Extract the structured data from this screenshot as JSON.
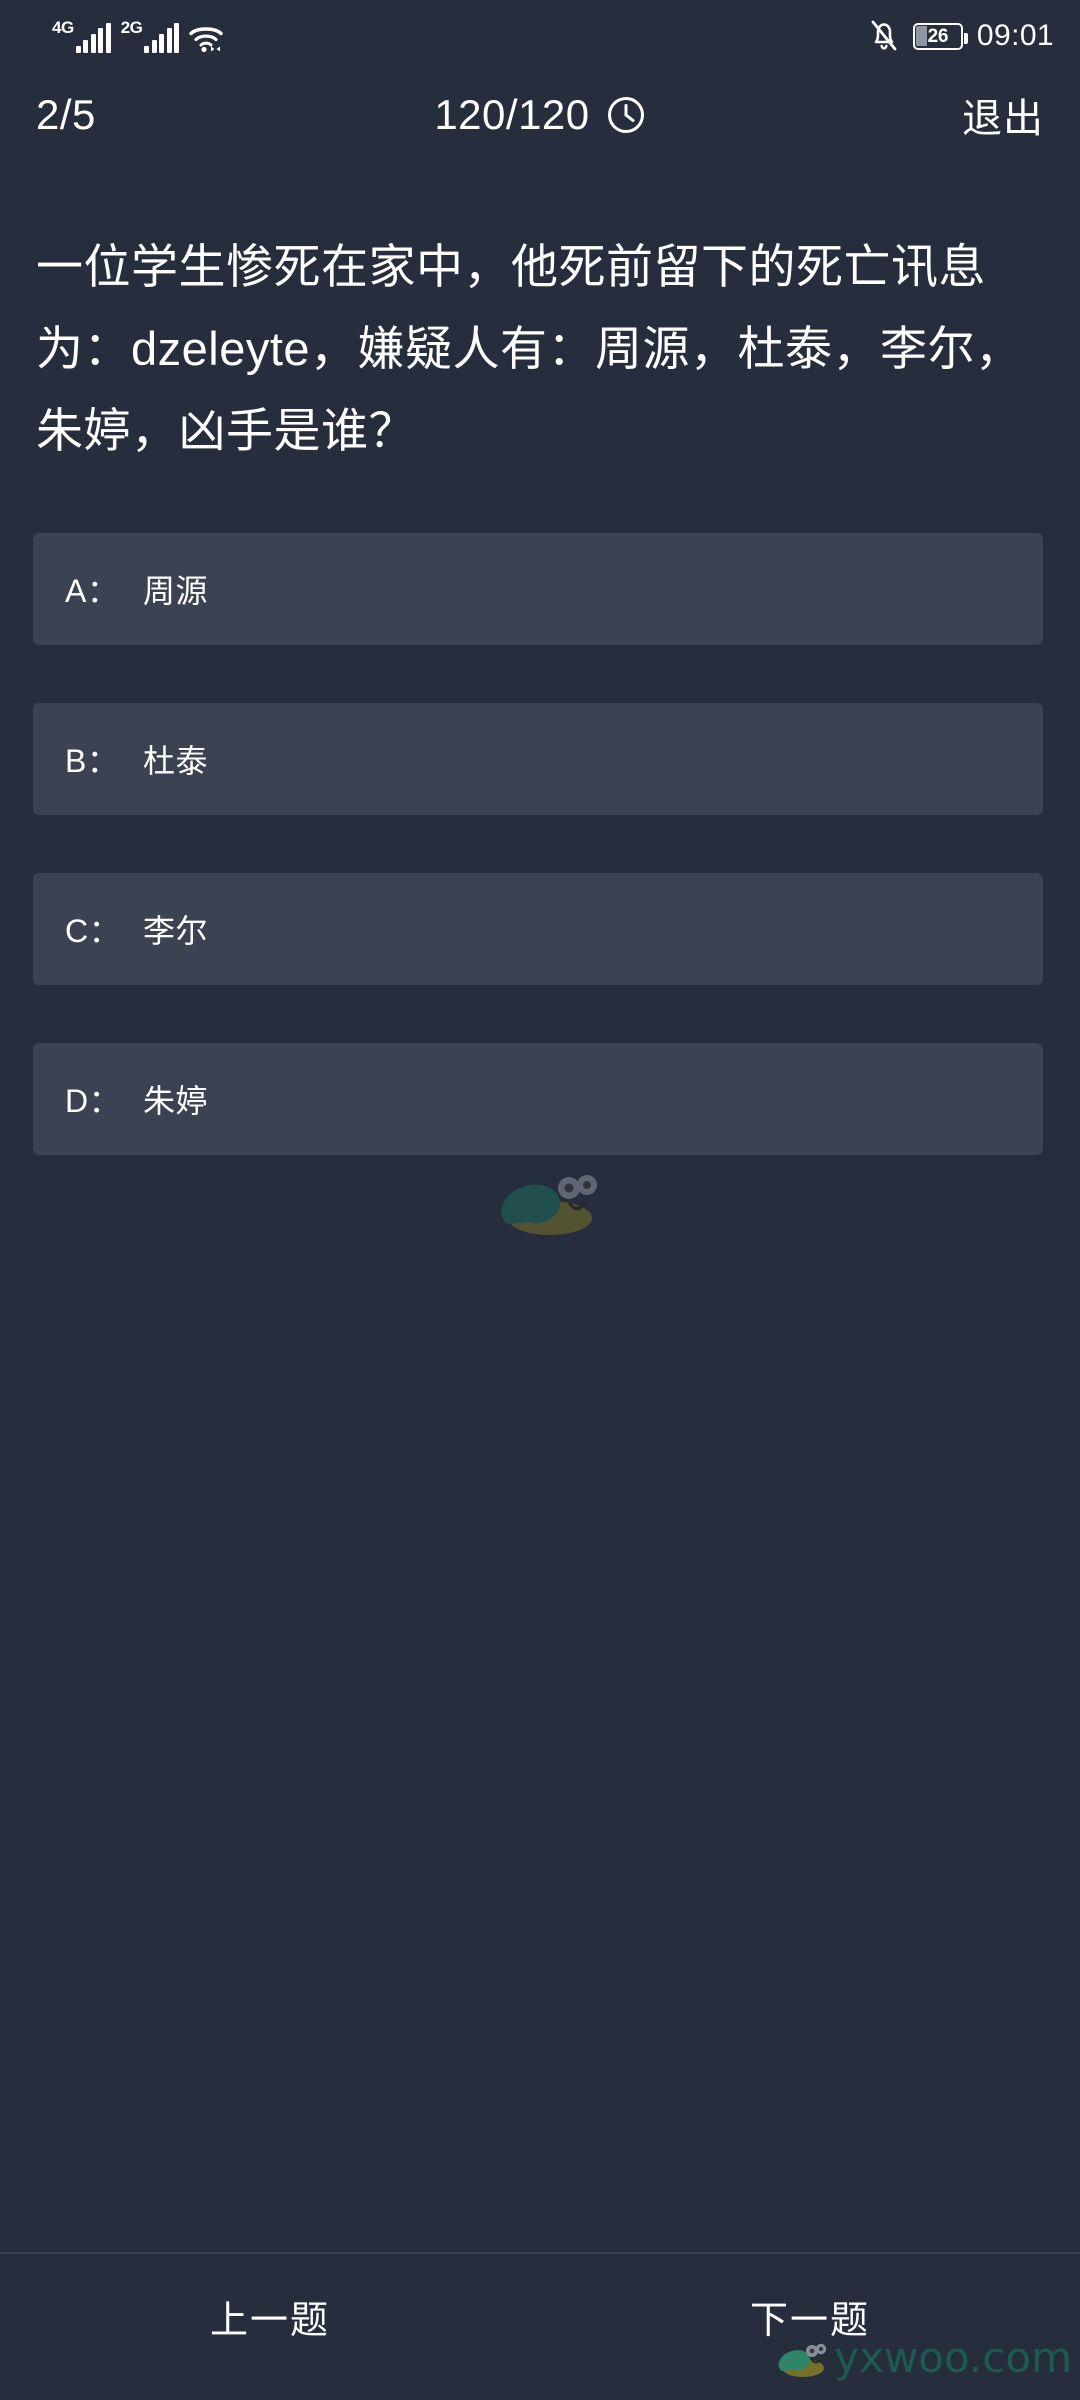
{
  "status_bar": {
    "network_1": "4G",
    "network_2": "2G",
    "wifi_icon": "wifi-icon",
    "bell_icon": "bell-off-icon",
    "battery_level": "26",
    "time": "09:01"
  },
  "header": {
    "progress": "2/5",
    "timer": "120/120",
    "timer_icon": "clock-icon",
    "exit_label": "退出"
  },
  "question": {
    "text": "一位学生惨死在家中，他死前留下的死亡讯息为：dzeleyte，嫌疑人有：周源，杜泰，李尔，朱婷，凶手是谁？"
  },
  "options": [
    {
      "letter": "A：",
      "text": "周源"
    },
    {
      "letter": "B：",
      "text": "杜泰"
    },
    {
      "letter": "C：",
      "text": "李尔"
    },
    {
      "letter": "D：",
      "text": "朱婷"
    }
  ],
  "bottom_nav": {
    "prev_label": "上一题",
    "next_label": "下一题"
  },
  "watermark": {
    "site_text": "yxwoo.com",
    "snail_icon": "snail-icon",
    "shell_color": "#1d6b5e",
    "body_color": "#7a7329",
    "text_color": "#1d5d52"
  },
  "theme": {
    "background": "#262d3c",
    "card_background": "#3b4251",
    "text_color": "#ffffff",
    "divider_color": "#38404f"
  }
}
